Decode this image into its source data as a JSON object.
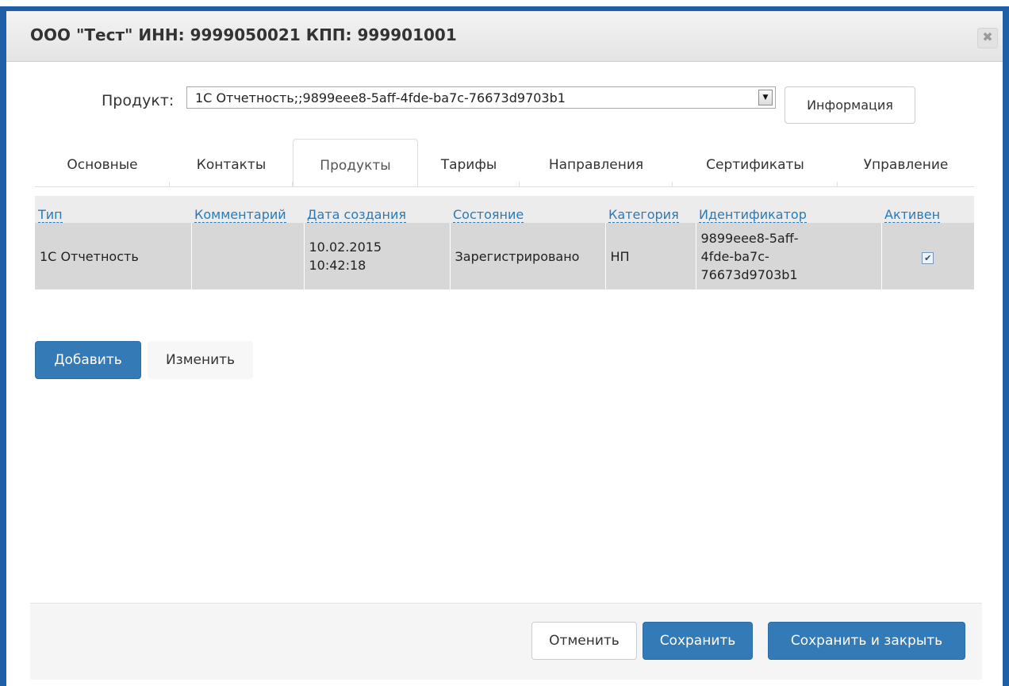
{
  "dialog": {
    "title": "ООО \"Тест\" ИНН: 9999050021 КПП: 999901001",
    "close_icon": "close-icon"
  },
  "product": {
    "label": "Продукт:",
    "selected": "1С Отчетность;;9899eee8-5aff-4fde-ba7c-76673d9703b1",
    "info_button": "Информация"
  },
  "tabs": [
    {
      "label": "Основные"
    },
    {
      "label": "Контакты"
    },
    {
      "label": "Продукты",
      "active": true
    },
    {
      "label": "Тарифы"
    },
    {
      "label": "Направления"
    },
    {
      "label": "Сертификаты"
    },
    {
      "label": "Управление"
    }
  ],
  "table": {
    "columns": [
      "Тип",
      "Комментарий",
      "Дата создания",
      "Состояние",
      "Категория",
      "Идентификатор",
      "Активен"
    ],
    "rows": [
      {
        "type": "1С Отчетность",
        "comment": "",
        "created_date": "10.02.2015",
        "created_time": "10:42:18",
        "state": "Зарегистрировано",
        "category": "НП",
        "id_line1": "9899eee8-5aff-",
        "id_line2": "4fde-ba7c-",
        "id_line3": "76673d9703b1",
        "active": true
      }
    ]
  },
  "actions": {
    "add": "Добавить",
    "edit": "Изменить"
  },
  "footer": {
    "cancel": "Отменить",
    "save": "Сохранить",
    "save_close": "Сохранить и закрыть"
  },
  "colors": {
    "frame": "#1f5fa6",
    "primary": "#337ab7",
    "link": "#2a7ab8",
    "row_bg": "#d7d7d7"
  }
}
